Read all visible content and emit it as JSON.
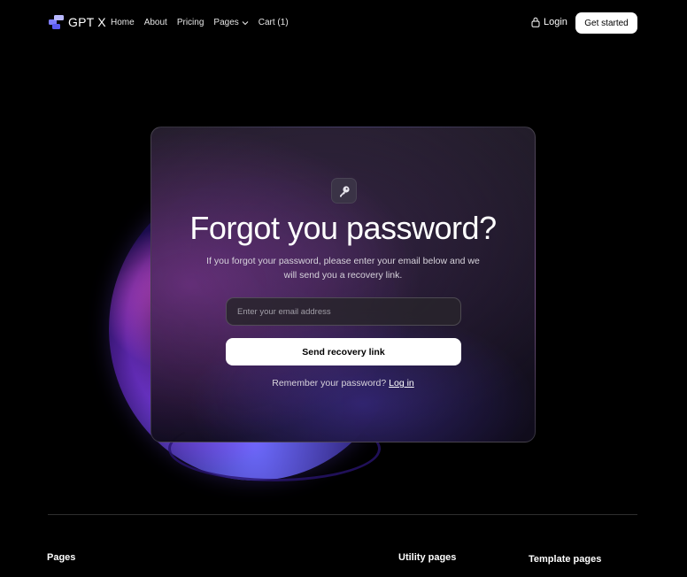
{
  "nav": {
    "brand": {
      "logo_icon": "gpt-x-logo-icon",
      "name": "GPT X"
    },
    "links": [
      {
        "label": "Home"
      },
      {
        "label": "About"
      },
      {
        "label": "Pricing"
      },
      {
        "label": "Pages",
        "icon": "chevron-down-icon"
      },
      {
        "label": "Cart (1)"
      }
    ],
    "login": {
      "label": "Login",
      "icon": "lock-icon"
    },
    "cta": {
      "label": "Get started"
    }
  },
  "card": {
    "icon": "key-icon",
    "title": "Forgot you password?",
    "description": "If you forgot your password, please enter your email below and we will send you a recovery link.",
    "email_input": {
      "placeholder": "Enter your email address",
      "value": ""
    },
    "submit_label": "Send recovery link",
    "remember_text": "Remember your password?",
    "login_link": "Log in"
  },
  "footer": {
    "columns": [
      {
        "title": "Pages"
      },
      {
        "title": "Utility pages"
      },
      {
        "title": "Template pages"
      }
    ]
  },
  "colors": {
    "background": "#000000",
    "button_bg": "#ffffff",
    "orb_pink": "#ff5cf0",
    "orb_purple": "#9b3cff",
    "orb_blue": "#6d6cff"
  }
}
